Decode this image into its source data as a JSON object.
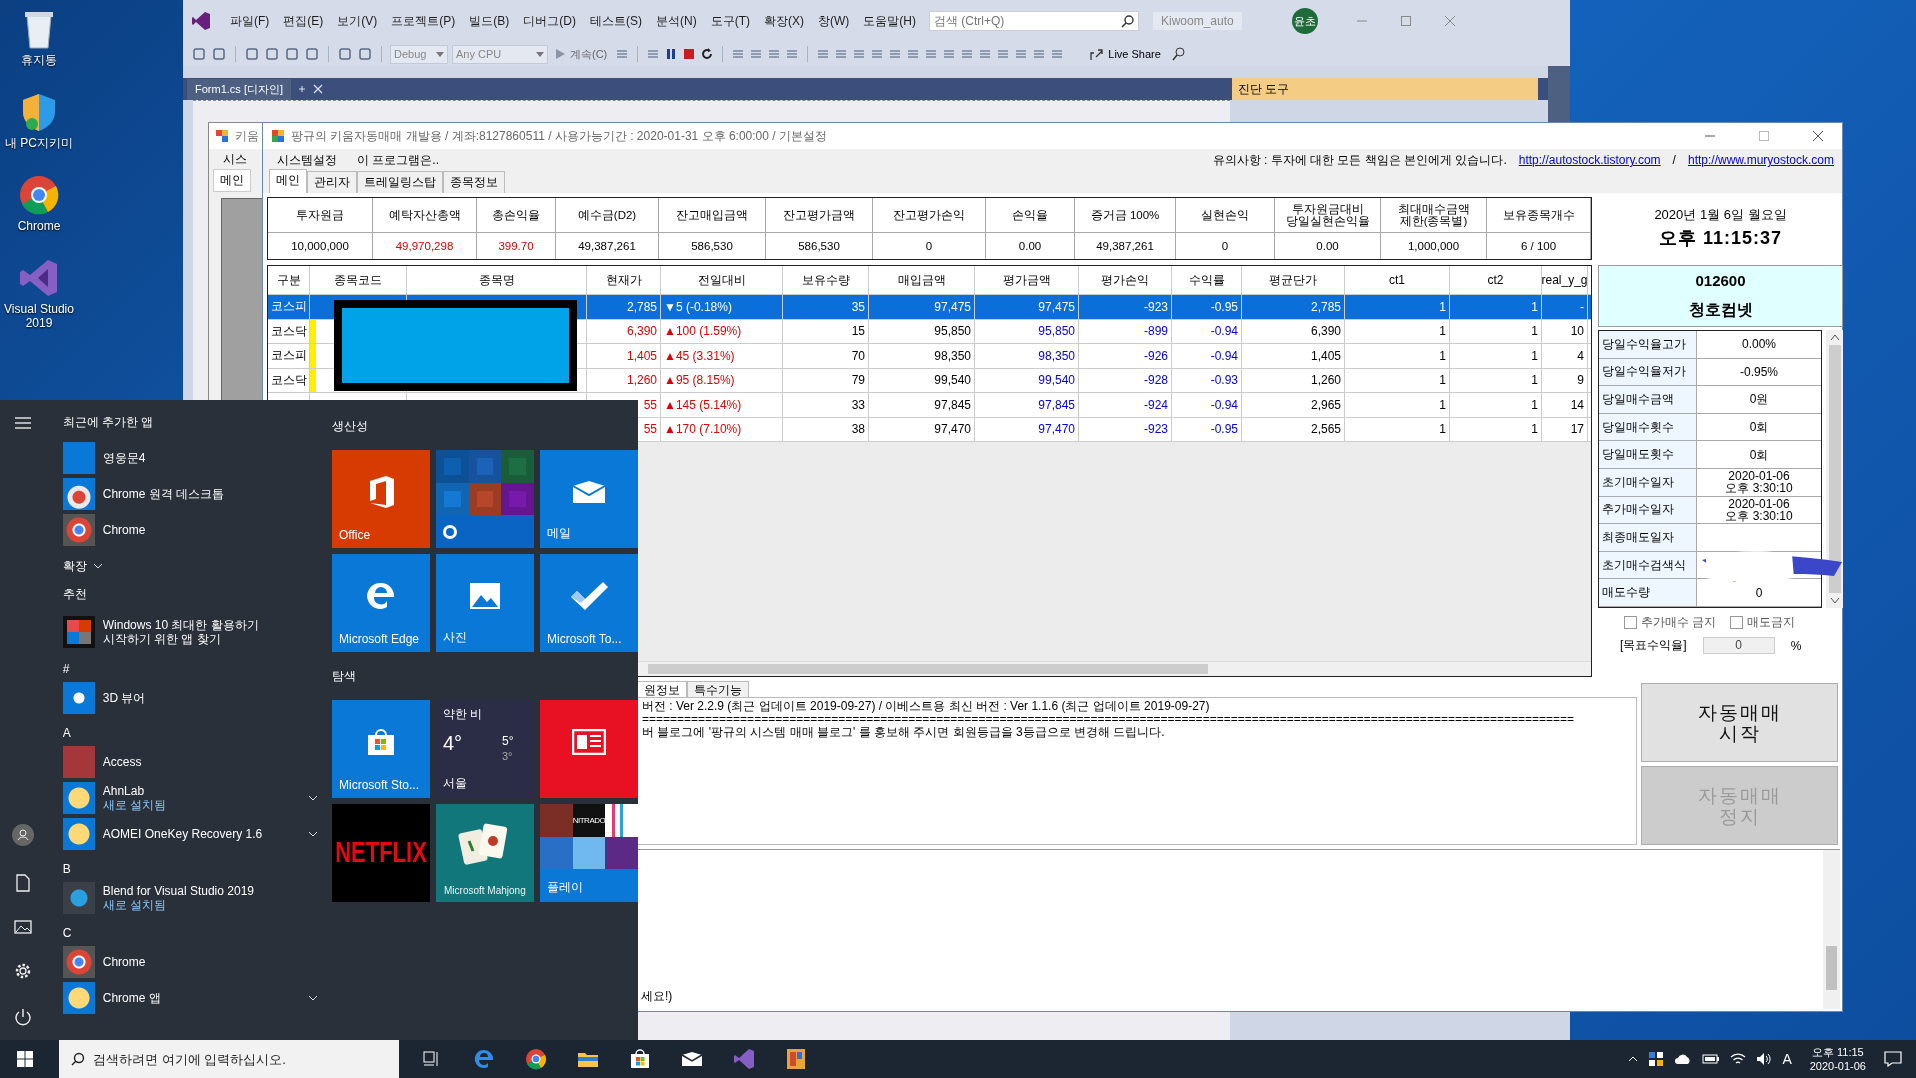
{
  "desktop_icons": [
    {
      "label": "휴지통",
      "kind": "recycle"
    },
    {
      "label": "내 PC지키미",
      "kind": "shield"
    },
    {
      "label": "Chrome",
      "kind": "chrome"
    },
    {
      "label": "Visual Studio 2019",
      "kind": "vs"
    }
  ],
  "ide": {
    "menu": [
      "파일(F)",
      "편집(E)",
      "보기(V)",
      "프로젝트(P)",
      "빌드(B)",
      "디버그(D)",
      "테스트(S)",
      "분석(N)",
      "도구(T)",
      "확장(X)",
      "창(W)",
      "도움말(H)"
    ],
    "search": {
      "placeholder": "검색 (Ctrl+Q)"
    },
    "solution": "Kiwoom_auto",
    "avatar": "윤초",
    "toolbar": {
      "configuration": "Debug",
      "platform": "Any CPU",
      "continue": "계속(C)",
      "live_share": "Live Share"
    },
    "document_tab": "Form1.cs [디자인]",
    "tool_panel": "진단 도구"
  },
  "back_window": {
    "title": "키움",
    "menu": "시스",
    "tab": "메인"
  },
  "app": {
    "title": "팡규의 키움자동매매 개발용 / 계좌:8127860511 / 사용가능기간 : 2020-01-31 오후 6:00:00 / 기본설정",
    "menu": [
      "시스템설정",
      "이 프로그램은.."
    ],
    "notice": "유의사항 : 투자에 대한 모든 책임은 본인에게 있습니다.",
    "links": [
      "http://autostock.tistory.com",
      "http://www.muryostock.com"
    ],
    "link_separator": "/",
    "tabs": [
      {
        "label": "메인",
        "selected": true
      },
      {
        "label": "관리자",
        "selected": false
      },
      {
        "label": "트레일링스탑",
        "selected": false
      },
      {
        "label": "종목정보",
        "selected": false
      }
    ],
    "summary": {
      "columns": [
        "투자원금",
        "예탁자산총액",
        "총손익율",
        "예수금(D2)",
        "잔고매입금액",
        "잔고평가금액",
        "잔고평가손익",
        "손익율",
        "증거금 100%",
        "실현손익",
        "투자원금대비\n당일실현손익율",
        "최대매수금액\n제한(종목별)",
        "보유종목개수"
      ],
      "values": [
        {
          "text": "10,000,000",
          "emphasized": false
        },
        {
          "text": "49,970,298",
          "emphasized": true
        },
        {
          "text": "399.70",
          "emphasized": true
        },
        {
          "text": "49,387,261",
          "emphasized": false
        },
        {
          "text": "586,530",
          "emphasized": false
        },
        {
          "text": "586,530",
          "emphasized": false
        },
        {
          "text": "0",
          "emphasized": false
        },
        {
          "text": "0.00",
          "emphasized": false
        },
        {
          "text": "49,387,261",
          "emphasized": false
        },
        {
          "text": "0",
          "emphasized": false
        },
        {
          "text": "0.00",
          "emphasized": false
        },
        {
          "text": "1,000,000",
          "emphasized": false
        },
        {
          "text": "6 / 100",
          "emphasized": false
        }
      ]
    },
    "date": "2020년 1월 6일 월요일",
    "time": "오후 11:15:37",
    "grid": {
      "columns": [
        "구분",
        "종목코드",
        "종목명",
        "현재가",
        "전일대비",
        "보유수량",
        "매입금액",
        "평가금액",
        "평가손익",
        "수익률",
        "평균단가",
        "ct1",
        "ct2",
        "real_y_g"
      ],
      "rows": [
        {
          "market": "코스피",
          "flag": false,
          "price": "2,785",
          "change": "▼5 (-0.18%)",
          "rising": false,
          "qty": "35",
          "buy": "97,475",
          "eval": "97,475",
          "pl": "-923",
          "rate": "-0.95",
          "avg": "2,785",
          "ct1": "1",
          "ct2": "1",
          "real": "-",
          "loss": true,
          "selected": true
        },
        {
          "market": "코스닥",
          "flag": true,
          "price": "6,390",
          "change": "▲100 (1.59%)",
          "rising": true,
          "qty": "15",
          "buy": "95,850",
          "eval": "95,850",
          "pl": "-899",
          "rate": "-0.94",
          "avg": "6,390",
          "ct1": "1",
          "ct2": "1",
          "real": "10",
          "loss": true,
          "selected": false
        },
        {
          "market": "코스피",
          "flag": true,
          "price": "1,405",
          "change": "▲45 (3.31%)",
          "rising": true,
          "qty": "70",
          "buy": "98,350",
          "eval": "98,350",
          "pl": "-926",
          "rate": "-0.94",
          "avg": "1,405",
          "ct1": "1",
          "ct2": "1",
          "real": "4",
          "loss": true,
          "selected": false
        },
        {
          "market": "코스닥",
          "flag": true,
          "price": "1,260",
          "change": "▲95 (8.15%)",
          "rising": true,
          "qty": "79",
          "buy": "99,540",
          "eval": "99,540",
          "pl": "-928",
          "rate": "-0.93",
          "avg": "1,260",
          "ct1": "1",
          "ct2": "1",
          "real": "9",
          "loss": true,
          "selected": false
        },
        {
          "price": "55",
          "change": "▲145 (5.14%)",
          "rising": true,
          "qty": "33",
          "buy": "97,845",
          "eval": "97,845",
          "pl": "-924",
          "rate": "-0.94",
          "avg": "2,965",
          "ct1": "1",
          "ct2": "1",
          "real": "14",
          "loss": true,
          "selected": false
        },
        {
          "price": "55",
          "change": "▲170 (7.10%)",
          "rising": true,
          "qty": "38",
          "buy": "97,470",
          "eval": "97,470",
          "pl": "-923",
          "rate": "-0.95",
          "avg": "2,565",
          "ct1": "1",
          "ct2": "1",
          "real": "17",
          "loss": true,
          "selected": false
        }
      ]
    },
    "stock": {
      "code": "012600",
      "name": "청호컴넷"
    },
    "info": [
      {
        "label": "당일수익율고가",
        "value": "0.00%",
        "kind": "text"
      },
      {
        "label": "당일수익율저가",
        "value": "-0.95%",
        "kind": "text"
      },
      {
        "label": "당일매수금액",
        "value": "0원",
        "kind": "text"
      },
      {
        "label": "당일매수횟수",
        "value": "0회",
        "kind": "text"
      },
      {
        "label": "당일매도횟수",
        "value": "0회",
        "kind": "text"
      },
      {
        "label": "초기매수일자",
        "value": "2020-01-06\n오후 3:30:10",
        "kind": "text"
      },
      {
        "label": "추가매수일자",
        "value": "2020-01-06\n오후 3:30:10",
        "kind": "text"
      },
      {
        "label": "최종매도일자",
        "kind": "text"
      },
      {
        "label": "초기매수검색식",
        "kind": "masked"
      },
      {
        "label": "매도수량",
        "value": "0",
        "kind": "text"
      }
    ],
    "checkboxes": [
      {
        "label": "추가매수 금지",
        "checked": false
      },
      {
        "label": "매도금지",
        "checked": false
      }
    ],
    "target": {
      "label": "[목표수익율]",
      "value": "0",
      "unit": "%"
    },
    "buttons": [
      {
        "label": "자동매매\n시작",
        "disabled": false
      },
      {
        "label": "자동매매\n정지",
        "disabled": true
      }
    ],
    "lower_tabs": [
      {
        "label": "원정보",
        "selected": true
      },
      {
        "label": "특수기능",
        "selected": false
      }
    ],
    "log": [
      "버전 : Ver 2.2.9 (최근 업데이트 2019-09-27) / 이베스트용 최신 버전 : Ver 1.1.6 (최근 업데이트 2019-09-27)",
      "=====================================================================================================================================",
      "버 블로그에 '팡규의 시스템 매매 블로그' 를 홍보해 주시면 회원등급을 3등급으로 변경해 드립니다."
    ],
    "bottom_log": "세요!)"
  },
  "start_menu": {
    "recent_header": "최근에 추가한 앱",
    "recent": [
      {
        "label": "영웅문4",
        "kind": "doc"
      },
      {
        "label": "Chrome 원격 데스크톱",
        "kind": "remote"
      },
      {
        "label": "Chrome",
        "kind": "chrome"
      }
    ],
    "expand": "확장",
    "recommended_header": "추천",
    "recommended": [
      "Windows 10 최대한 활용하기",
      "시작하기 위한 앱 찾기"
    ],
    "sections": [
      {
        "letter": "#",
        "apps": [
          {
            "label": "3D 뷰어",
            "kind": "cube",
            "expandable": false
          }
        ]
      },
      {
        "letter": "A",
        "apps": [
          {
            "label": "Access",
            "kind": "access",
            "expandable": false
          },
          {
            "label": "AhnLab",
            "sub": "새로 설치됨",
            "kind": "folder",
            "expandable": true
          },
          {
            "label": "AOMEI OneKey Recovery 1.6",
            "kind": "folder",
            "expandable": true
          }
        ]
      },
      {
        "letter": "B",
        "apps": [
          {
            "label": "Blend for Visual Studio 2019",
            "sub": "새로 설치됨",
            "kind": "blend",
            "expandable": false
          }
        ]
      },
      {
        "letter": "C",
        "apps": [
          {
            "label": "Chrome",
            "kind": "chrome",
            "expandable": false
          },
          {
            "label": "Chrome 앱",
            "kind": "folder",
            "expandable": true
          }
        ]
      }
    ],
    "groups": [
      {
        "title": "생산성",
        "tiles": [
          {
            "kind": "office",
            "label": "Office"
          },
          {
            "kind": "office-apps"
          },
          {
            "kind": "mail",
            "label": "메일"
          },
          {
            "kind": "edge",
            "label": "Microsoft Edge"
          },
          {
            "kind": "photos",
            "label": "사진"
          },
          {
            "kind": "todo",
            "label": "Microsoft To..."
          }
        ]
      },
      {
        "title": "탐색",
        "tiles": [
          {
            "kind": "store",
            "label": "Microsoft Sto..."
          },
          {
            "kind": "weather",
            "label": "서울",
            "condition": "약한 비",
            "temp": "4°",
            "high": "5°",
            "low": "3°"
          },
          {
            "kind": "news"
          },
          {
            "kind": "netflix",
            "label": "NETFLIX"
          },
          {
            "kind": "mahjong",
            "label": "Microsoft Mahjong"
          },
          {
            "kind": "play",
            "label": "플레이",
            "badge": "NITRADO"
          }
        ]
      }
    ]
  },
  "taskbar": {
    "search": {
      "placeholder": "검색하려면 여기에 입력하십시오."
    },
    "apps": [
      {
        "kind": "taskview"
      },
      {
        "kind": "edge"
      },
      {
        "kind": "chrome"
      },
      {
        "kind": "explorer"
      },
      {
        "kind": "store"
      },
      {
        "kind": "mail"
      },
      {
        "kind": "vs"
      },
      {
        "kind": "app"
      }
    ],
    "ime": "A",
    "time": "오후 11:15",
    "date": "2020-01-06"
  }
}
